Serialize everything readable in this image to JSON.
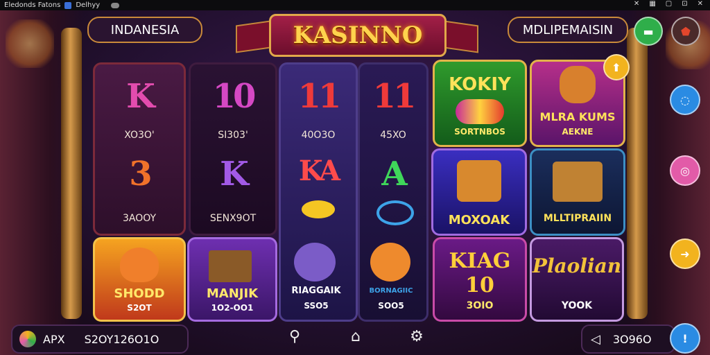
{
  "topbar": {
    "app_name": "Eledonds Fatons",
    "tab_label": "Delhyy"
  },
  "header": {
    "left_pill": "INDANESIA",
    "title": "KASINNO",
    "right_pill": "MDLIPEMAISIN"
  },
  "reels": [
    {
      "top_symbol": "K",
      "top_caption": "XO3O'",
      "bottom_symbol": "3",
      "bottom_caption": "3AOOY"
    },
    {
      "top_symbol": "10",
      "top_caption": "SI303'",
      "bottom_symbol": "K",
      "bottom_caption": "SENX9OT"
    },
    {
      "top_symbol": "11",
      "top_caption": "40O3O",
      "bottom_symbol": "KA",
      "bottom_caption": ""
    },
    {
      "top_symbol": "11",
      "top_caption": "45XO",
      "bottom_symbol": "A",
      "bottom_caption": ""
    }
  ],
  "tiles": {
    "fox": {
      "title": "SHODD",
      "caption": "S2OT"
    },
    "manjik": {
      "title": "MANJIK",
      "caption": "1O2-OO1"
    },
    "wolf": {
      "title": "RIAGGAIK",
      "caption": "SSO5"
    },
    "dog": {
      "title": "BORNAGIIC",
      "caption": "SOO5"
    },
    "koky": {
      "title": "KOKIY",
      "caption": "SORTNBOS"
    },
    "mlra": {
      "title": "MLRA KUMS",
      "caption": "AEKNE"
    },
    "moxoak": {
      "title": "MOXOAK",
      "caption": ""
    },
    "multip": {
      "title": "MLLTIPRAIIN",
      "caption": ""
    },
    "kiag": {
      "title": "KIAG 10",
      "caption": "3OIO"
    },
    "plaolian": {
      "title": "Plaolian",
      "caption": "YOOK"
    }
  },
  "bottom": {
    "apk_label": "APX",
    "balance": "S2OY126O1O",
    "right_value": "3O96O"
  },
  "colors": {
    "green": "#2fae4a",
    "blue": "#2a8be3",
    "pink": "#e25ba8",
    "gold": "#f2b31e",
    "maroon": "#8d2030"
  }
}
